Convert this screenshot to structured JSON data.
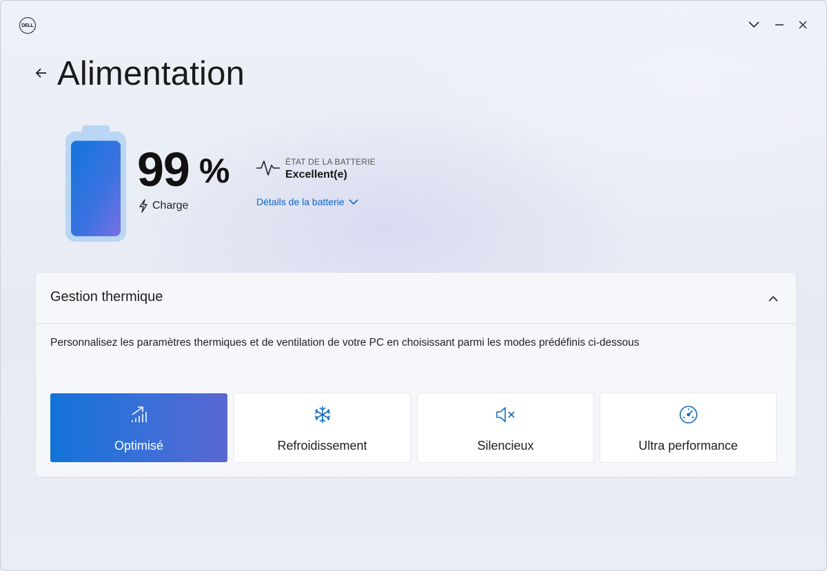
{
  "app": {
    "logo_text": "DELL"
  },
  "page": {
    "title": "Alimentation"
  },
  "battery": {
    "percent": "99",
    "unit": "%",
    "level": 0.99,
    "status_label": "Charge",
    "health_caption": "ÉTAT DE LA BATTERIE",
    "health_value": "Excellent(e)",
    "details_link": "Détails de la batterie"
  },
  "thermal": {
    "title": "Gestion thermique",
    "description": "Personnalisez les paramètres thermiques et de ventilation de votre PC en choisissant parmi les modes prédéfinis ci-dessous",
    "modes": [
      {
        "label": "Optimisé",
        "icon": "bars-trend-up-icon",
        "selected": true
      },
      {
        "label": "Refroidissement",
        "icon": "snowflake-icon",
        "selected": false
      },
      {
        "label": "Silencieux",
        "icon": "speaker-mute-icon",
        "selected": false
      },
      {
        "label": "Ultra performance",
        "icon": "speedometer-icon",
        "selected": false
      }
    ]
  },
  "colors": {
    "accent": "#0b63c5",
    "selected_start": "#1273d8",
    "selected_end": "#5966d0",
    "icon_blue": "#0f6cbd"
  }
}
